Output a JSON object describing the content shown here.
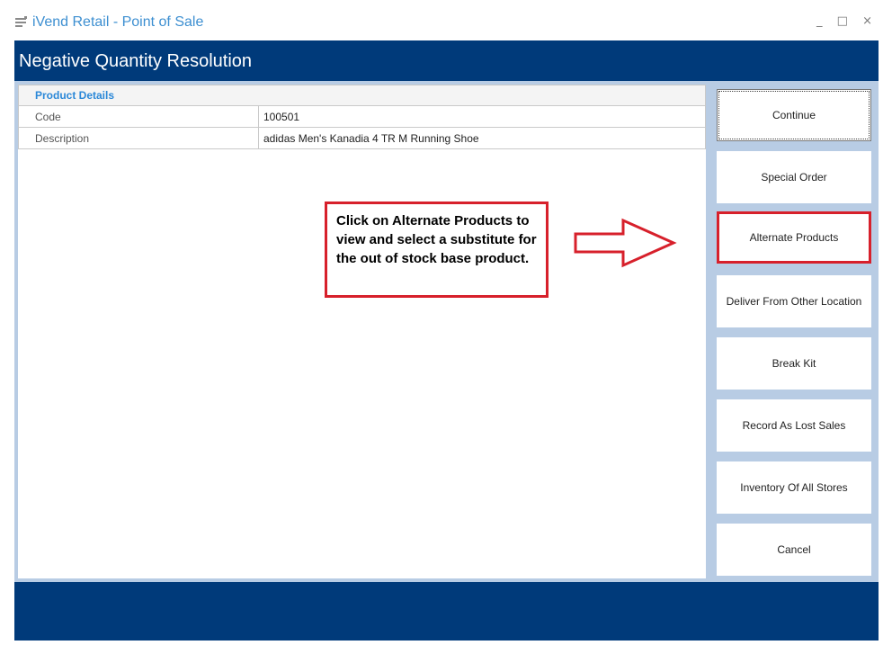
{
  "window": {
    "title": "iVend Retail - Point of Sale",
    "minimize": "_",
    "maximize": "□",
    "close": "×"
  },
  "header": {
    "title": "Negative Quantity Resolution"
  },
  "product_details": {
    "heading": "Product Details",
    "rows": [
      {
        "label": "Code",
        "value": "100501"
      },
      {
        "label": "Description",
        "value": "adidas Men's Kanadia 4 TR M Running Shoe"
      }
    ]
  },
  "callout": {
    "text": "Click on Alternate Products to view and select a substitute for the out of stock base product."
  },
  "actions": [
    {
      "label": "Continue"
    },
    {
      "label": "Special Order"
    },
    {
      "label": "Alternate Products"
    },
    {
      "label": "Deliver From Other Location"
    },
    {
      "label": "Break Kit"
    },
    {
      "label": "Record As Lost Sales"
    },
    {
      "label": "Inventory Of All Stores"
    },
    {
      "label": "Cancel"
    }
  ],
  "colors": {
    "header_bg": "#003a7a",
    "body_bg": "#b8cce4",
    "title_text": "#3d8fd1",
    "highlight": "#d7202b"
  }
}
